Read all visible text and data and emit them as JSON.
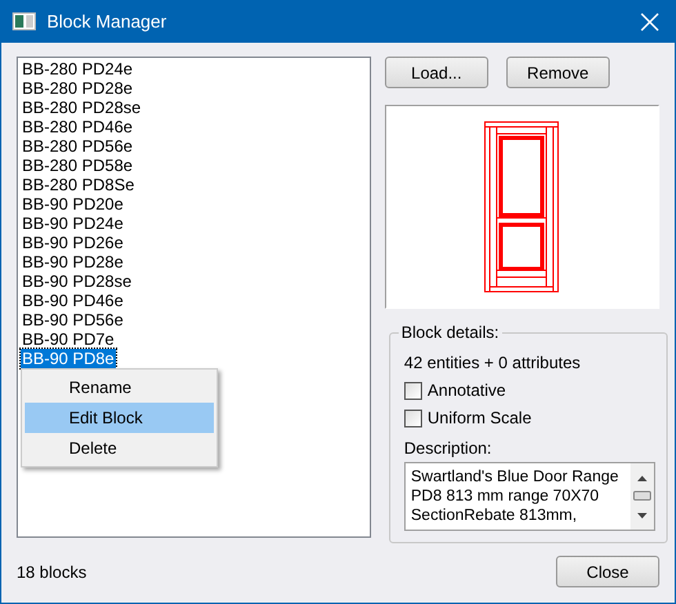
{
  "window": {
    "title": "Block Manager"
  },
  "blocks": [
    {
      "name": "BB-280 PD24e",
      "selected": false
    },
    {
      "name": "BB-280 PD28e",
      "selected": false
    },
    {
      "name": "BB-280 PD28se",
      "selected": false
    },
    {
      "name": "BB-280 PD46e",
      "selected": false
    },
    {
      "name": "BB-280 PD56e",
      "selected": false
    },
    {
      "name": "BB-280 PD58e",
      "selected": false
    },
    {
      "name": "BB-280 PD8Se",
      "selected": false
    },
    {
      "name": "BB-90 PD20e",
      "selected": false
    },
    {
      "name": "BB-90 PD24e",
      "selected": false
    },
    {
      "name": "BB-90 PD26e",
      "selected": false
    },
    {
      "name": "BB-90 PD28e",
      "selected": false
    },
    {
      "name": "BB-90 PD28se",
      "selected": false
    },
    {
      "name": "BB-90 PD46e",
      "selected": false
    },
    {
      "name": "BB-90 PD56e",
      "selected": false
    },
    {
      "name": "BB-90 PD7e",
      "selected": false
    },
    {
      "name": "BB-90 PD8e",
      "selected": true
    }
  ],
  "context_menu": [
    {
      "label": "Rename",
      "selected": false
    },
    {
      "label": "Edit Block",
      "selected": true
    },
    {
      "label": "Delete",
      "selected": false
    }
  ],
  "buttons": [
    "Load...",
    "Remove"
  ],
  "details": {
    "title": "Block details:",
    "summary": "42 entities + 0 attributes",
    "options": [
      {
        "label": "Annotative",
        "checked": false
      },
      {
        "label": "Uniform Scale",
        "checked": false
      }
    ],
    "description_label": "Description:",
    "description": "Swartland's Blue Door Range PD8 813 mm range 70X70 SectionRebate 813mm,"
  },
  "status": "18 blocks",
  "close_button": "Close"
}
